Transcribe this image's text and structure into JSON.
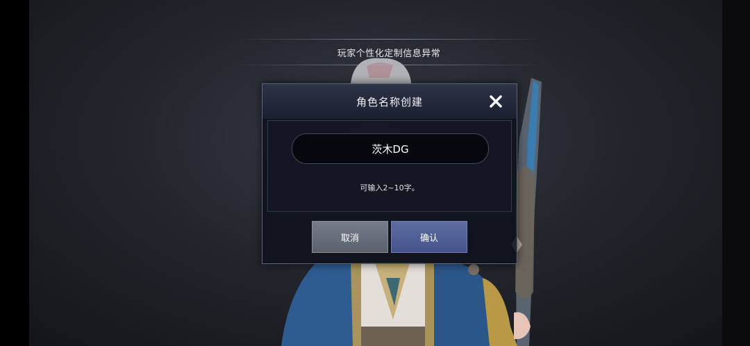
{
  "notice": {
    "text": "玩家个性化定制信息异常"
  },
  "dialog": {
    "title": "角色名称创建",
    "name_value": "茨木DG",
    "hint": "可输入2~10字。",
    "cancel_label": "取消",
    "confirm_label": "确认"
  },
  "icons": {
    "close": "close-icon"
  },
  "colors": {
    "confirm_button": "#4f5e96",
    "cancel_button": "#676d78",
    "dialog_bg": "#0e121c",
    "coat_blue": "#2f5a8e"
  }
}
